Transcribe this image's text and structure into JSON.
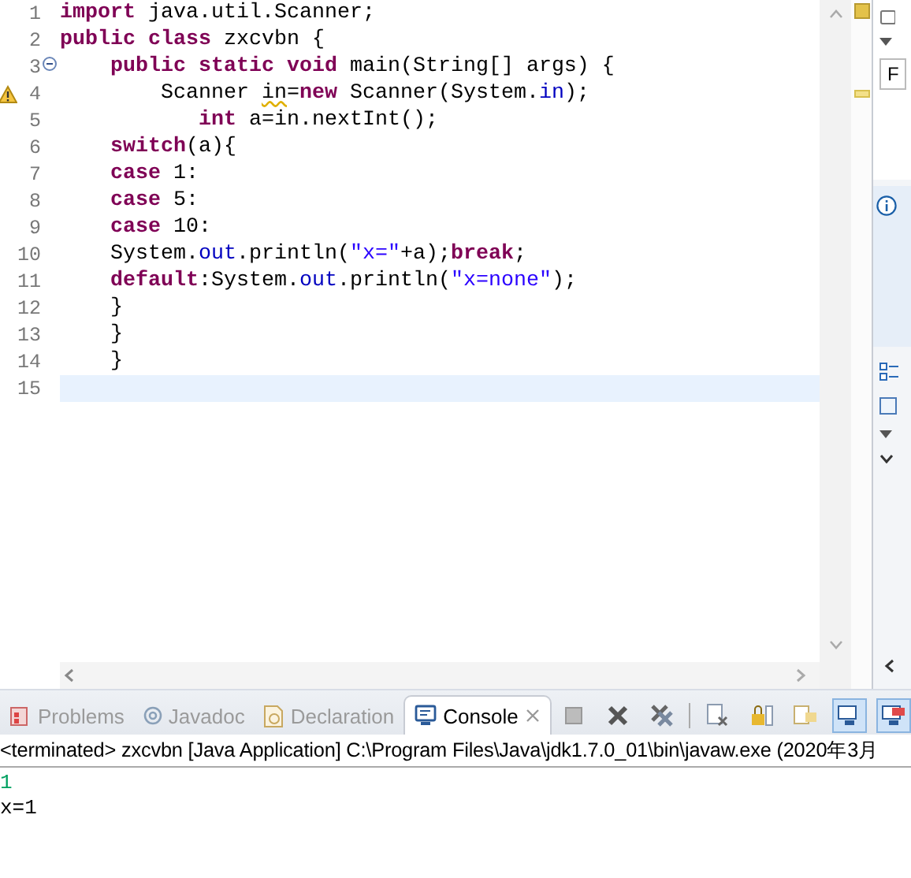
{
  "editor": {
    "lines": [
      {
        "number": "1",
        "current": false,
        "fold": false,
        "warning": false,
        "tokens": [
          {
            "kind": "keyword",
            "text": "import"
          },
          {
            "kind": "plain",
            "text": " java.util.Scanner;"
          }
        ]
      },
      {
        "number": "2",
        "current": false,
        "fold": false,
        "warning": false,
        "tokens": [
          {
            "kind": "keyword",
            "text": "public class"
          },
          {
            "kind": "plain",
            "text": " zxcvbn {"
          }
        ]
      },
      {
        "number": "3",
        "current": false,
        "fold": true,
        "warning": false,
        "tokens": [
          {
            "kind": "keyword",
            "text": "    public static void"
          },
          {
            "kind": "plain",
            "text": " main(String[] args) {"
          }
        ]
      },
      {
        "number": "4",
        "current": false,
        "fold": false,
        "warning": true,
        "tokens": [
          {
            "kind": "plain",
            "text": "        Scanner "
          },
          {
            "kind": "flagged",
            "text": "in"
          },
          {
            "kind": "plain",
            "text": "="
          },
          {
            "kind": "keyword",
            "text": "new"
          },
          {
            "kind": "plain",
            "text": " Scanner(System."
          },
          {
            "kind": "field",
            "text": "in"
          },
          {
            "kind": "plain",
            "text": ");"
          }
        ]
      },
      {
        "number": "5",
        "current": false,
        "fold": false,
        "warning": false,
        "tokens": [
          {
            "kind": "keyword",
            "text": "           int"
          },
          {
            "kind": "plain",
            "text": " a=in.nextInt();"
          }
        ]
      },
      {
        "number": "6",
        "current": false,
        "fold": false,
        "warning": false,
        "tokens": [
          {
            "kind": "keyword",
            "text": "    switch"
          },
          {
            "kind": "plain",
            "text": "(a){"
          }
        ]
      },
      {
        "number": "7",
        "current": false,
        "fold": false,
        "warning": false,
        "tokens": [
          {
            "kind": "keyword",
            "text": "    case"
          },
          {
            "kind": "plain",
            "text": " 1:"
          }
        ]
      },
      {
        "number": "8",
        "current": false,
        "fold": false,
        "warning": false,
        "tokens": [
          {
            "kind": "keyword",
            "text": "    case"
          },
          {
            "kind": "plain",
            "text": " 5:"
          }
        ]
      },
      {
        "number": "9",
        "current": false,
        "fold": false,
        "warning": false,
        "tokens": [
          {
            "kind": "keyword",
            "text": "    case"
          },
          {
            "kind": "plain",
            "text": " 10:"
          }
        ]
      },
      {
        "number": "10",
        "current": false,
        "fold": false,
        "warning": false,
        "tokens": [
          {
            "kind": "plain",
            "text": "    System."
          },
          {
            "kind": "field",
            "text": "out"
          },
          {
            "kind": "plain",
            "text": ".println("
          },
          {
            "kind": "string",
            "text": "\"x=\""
          },
          {
            "kind": "plain",
            "text": "+a);"
          },
          {
            "kind": "keyword",
            "text": "break"
          },
          {
            "kind": "plain",
            "text": ";"
          }
        ]
      },
      {
        "number": "11",
        "current": false,
        "fold": false,
        "warning": false,
        "tokens": [
          {
            "kind": "keyword",
            "text": "    default"
          },
          {
            "kind": "plain",
            "text": ":System."
          },
          {
            "kind": "field",
            "text": "out"
          },
          {
            "kind": "plain",
            "text": ".println("
          },
          {
            "kind": "string",
            "text": "\"x=none\""
          },
          {
            "kind": "plain",
            "text": ");"
          }
        ]
      },
      {
        "number": "12",
        "current": false,
        "fold": false,
        "warning": false,
        "tokens": [
          {
            "kind": "plain",
            "text": "    }"
          }
        ]
      },
      {
        "number": "13",
        "current": false,
        "fold": false,
        "warning": false,
        "tokens": [
          {
            "kind": "plain",
            "text": "    }"
          }
        ]
      },
      {
        "number": "14",
        "current": false,
        "fold": false,
        "warning": false,
        "tokens": [
          {
            "kind": "plain",
            "text": "    }"
          }
        ]
      },
      {
        "number": "15",
        "current": true,
        "fold": false,
        "warning": false
      }
    ]
  },
  "side_panel": {
    "field_text": "F"
  },
  "console": {
    "tabs": [
      {
        "label": "Problems",
        "kind": "problems",
        "selected": false
      },
      {
        "label": "Javadoc",
        "kind": "javadoc",
        "selected": false
      },
      {
        "label": "Declaration",
        "kind": "declaration",
        "selected": false
      },
      {
        "label": "Console",
        "kind": "console",
        "selected": true
      }
    ],
    "toolbar": [
      {
        "kind": "terminate",
        "selected": false
      },
      {
        "kind": "remove",
        "selected": false
      },
      {
        "kind": "remove-all",
        "selected": false
      },
      {
        "kind": "clear",
        "selected": false
      },
      {
        "kind": "lock",
        "selected": false
      },
      {
        "kind": "word-wrap",
        "selected": false
      },
      {
        "kind": "display",
        "selected": true
      },
      {
        "kind": "open",
        "selected": true
      }
    ],
    "status": "<terminated> zxcvbn [Java Application] C:\\Program Files\\Java\\jdk1.7.0_01\\bin\\javaw.exe (2020年3月",
    "output": [
      {
        "kind": "input",
        "text": "1"
      },
      {
        "kind": "output",
        "text": "x=1"
      }
    ]
  }
}
